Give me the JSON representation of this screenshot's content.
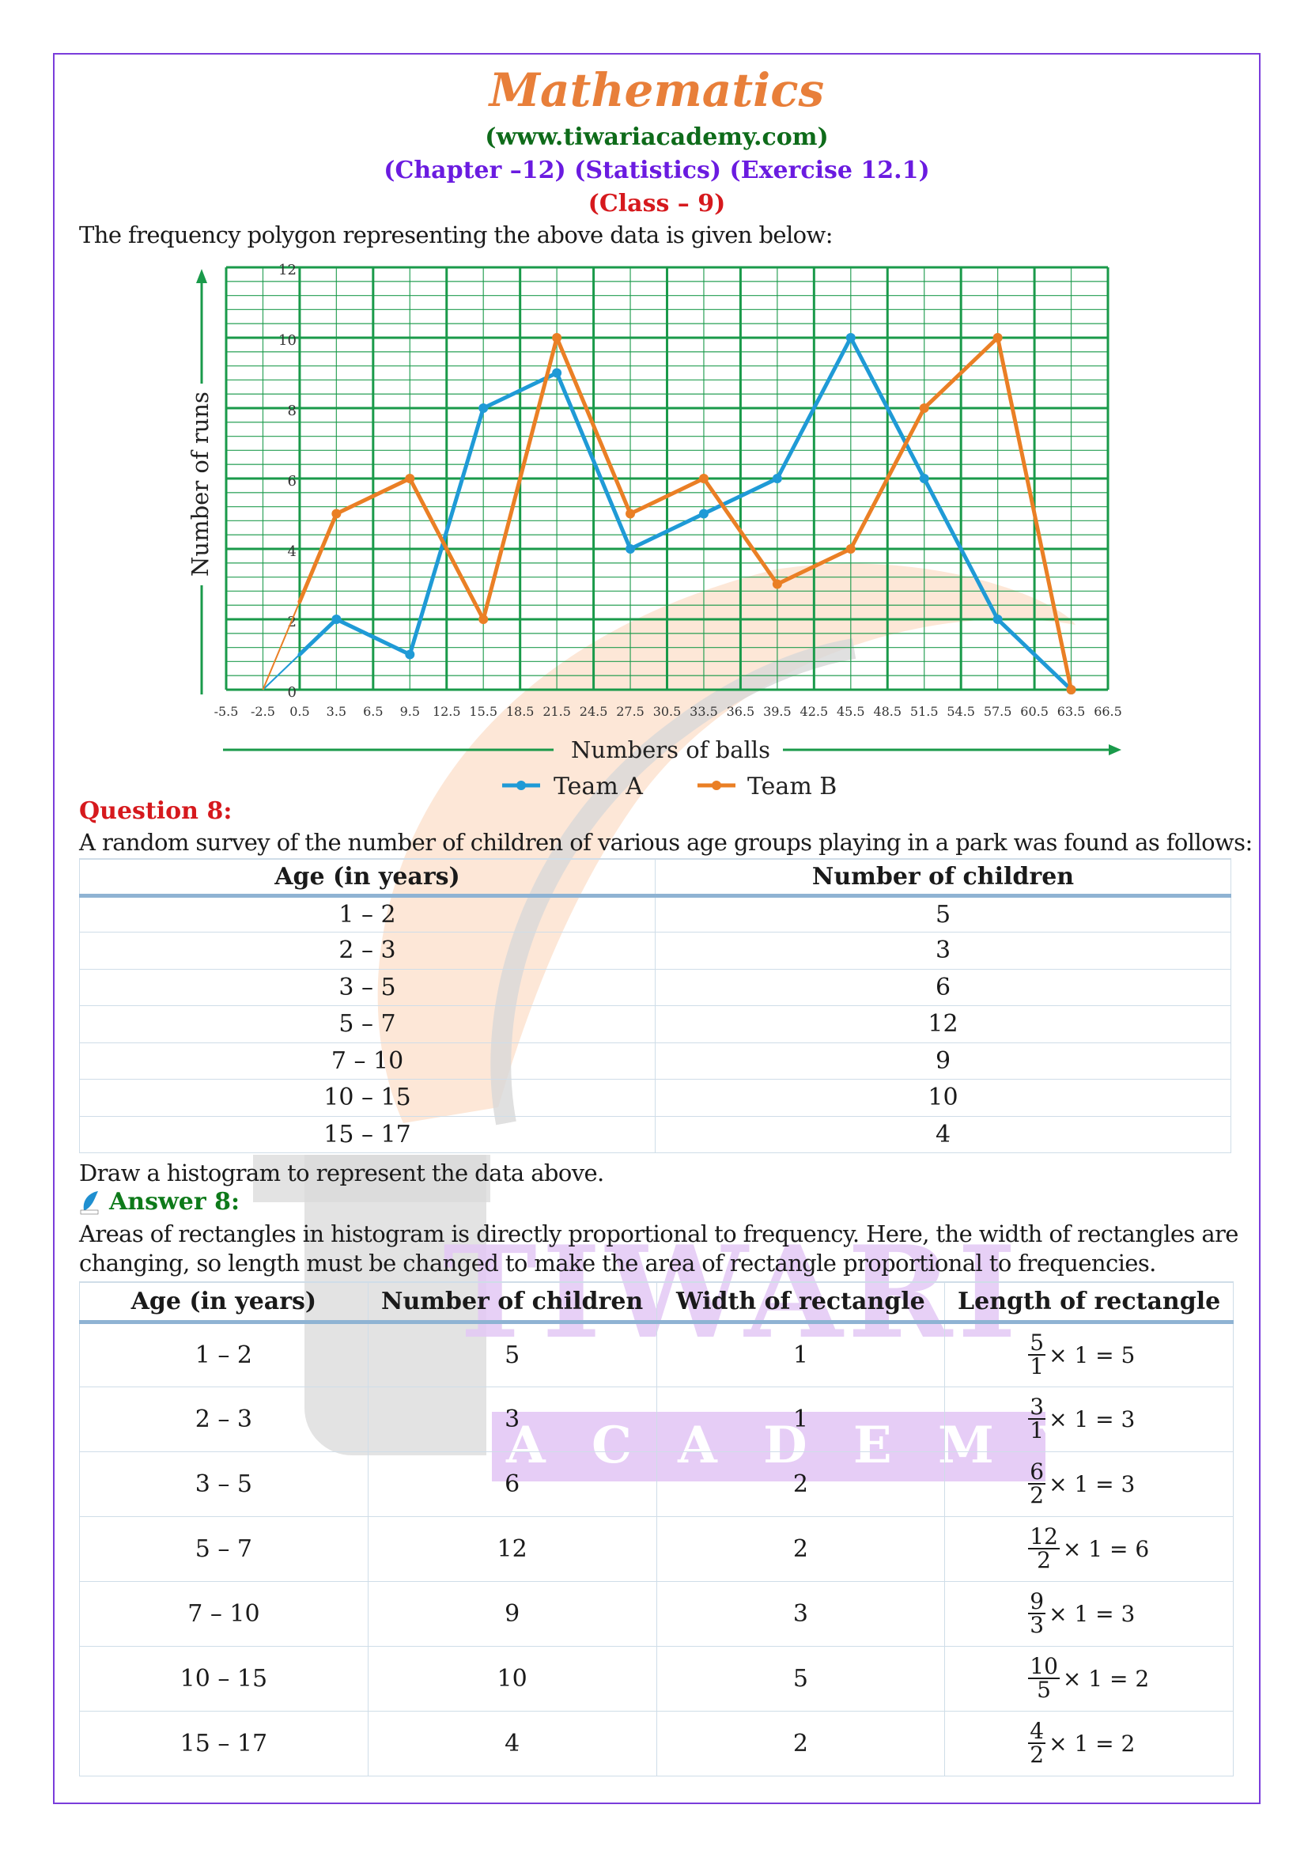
{
  "header": {
    "title": "Mathematics",
    "website": "(www.tiwariacademy.com)",
    "chapter": "(Chapter –12) (Statistics) (Exercise 12.1)",
    "class": "(Class – 9)"
  },
  "intro_text": "The frequency polygon representing the above data is given below:",
  "chart_data": {
    "type": "line",
    "title": "",
    "xlabel": "Numbers of balls",
    "ylabel": "Number of runs",
    "xlim": [
      -5.5,
      66.5
    ],
    "ylim": [
      0,
      12
    ],
    "grid": true,
    "x_ticks": [
      "-5.5",
      "-2.5",
      "0.5",
      "3.5",
      "6.5",
      "9.5",
      "12.5",
      "15.5",
      "18.5",
      "21.5",
      "24.5",
      "27.5",
      "30.5",
      "33.5",
      "36.5",
      "39.5",
      "42.5",
      "45.5",
      "48.5",
      "51.5",
      "54.5",
      "57.5",
      "60.5",
      "63.5",
      "66.5"
    ],
    "y_ticks": [
      "0",
      "2",
      "4",
      "6",
      "8",
      "10",
      "12"
    ],
    "legend_position": "bottom-center",
    "series": [
      {
        "name": "Team A",
        "color": "#1f9ad6",
        "x": [
          -2.5,
          3.5,
          9.5,
          15.5,
          21.5,
          27.5,
          33.5,
          39.5,
          45.5,
          51.5,
          57.5,
          63.5
        ],
        "y": [
          0,
          2,
          1,
          8,
          9,
          4,
          5,
          6,
          10,
          6,
          2,
          0
        ]
      },
      {
        "name": "Team B",
        "color": "#ea7f25",
        "x": [
          -2.5,
          3.5,
          9.5,
          15.5,
          21.5,
          27.5,
          33.5,
          39.5,
          45.5,
          51.5,
          57.5,
          63.5
        ],
        "y": [
          0,
          5,
          6,
          2,
          10,
          5,
          6,
          3,
          4,
          8,
          10,
          0
        ]
      }
    ]
  },
  "question": {
    "heading": "Question 8:",
    "text": "A random survey of the number of children of various age groups playing in a park was found as follows:",
    "table": {
      "headers": [
        "Age (in years)",
        "Number of children"
      ],
      "rows": [
        [
          "1 – 2",
          "5"
        ],
        [
          "2 – 3",
          "3"
        ],
        [
          "3 – 5",
          "6"
        ],
        [
          "5 – 7",
          "12"
        ],
        [
          "7 – 10",
          "9"
        ],
        [
          "10 – 15",
          "10"
        ],
        [
          "15 – 17",
          "4"
        ]
      ]
    },
    "instruction": "Draw a histogram to represent the data above."
  },
  "answer": {
    "heading": "Answer 8:",
    "paragraph_line1": "Areas of rectangles in histogram is directly proportional to frequency. Here, the width of rectangles are",
    "paragraph_line2": "changing, so length must be changed to make the area of rectangle proportional to frequencies.",
    "table": {
      "headers": [
        "Age (in years)",
        "Number of children",
        "Width of rectangle",
        "Length of rectangle"
      ],
      "rows": [
        {
          "age": "1 – 2",
          "children": "5",
          "width": "1",
          "num": "5",
          "den": "1",
          "rest": "× 1 = 5"
        },
        {
          "age": "2 – 3",
          "children": "3",
          "width": "1",
          "num": "3",
          "den": "1",
          "rest": "× 1 = 3"
        },
        {
          "age": "3 – 5",
          "children": "6",
          "width": "2",
          "num": "6",
          "den": "2",
          "rest": "× 1 = 3"
        },
        {
          "age": "5 – 7",
          "children": "12",
          "width": "2",
          "num": "12",
          "den": "2",
          "rest": "× 1 = 6"
        },
        {
          "age": "7 – 10",
          "children": "9",
          "width": "3",
          "num": "9",
          "den": "3",
          "rest": "× 1 = 3"
        },
        {
          "age": "10 – 15",
          "children": "10",
          "width": "5",
          "num": "10",
          "den": "5",
          "rest": "× 1 = 2"
        },
        {
          "age": "15 – 17",
          "children": "4",
          "width": "2",
          "num": "4",
          "den": "2",
          "rest": "× 1 = 2"
        }
      ]
    }
  },
  "watermark": {
    "line1": "TIWARI",
    "line2": "A C A D E M Y"
  },
  "colors": {
    "frame": "#7a3ddb",
    "grid": "#1a9a4a",
    "team_a": "#1f9ad6",
    "team_b": "#ea7f25"
  }
}
